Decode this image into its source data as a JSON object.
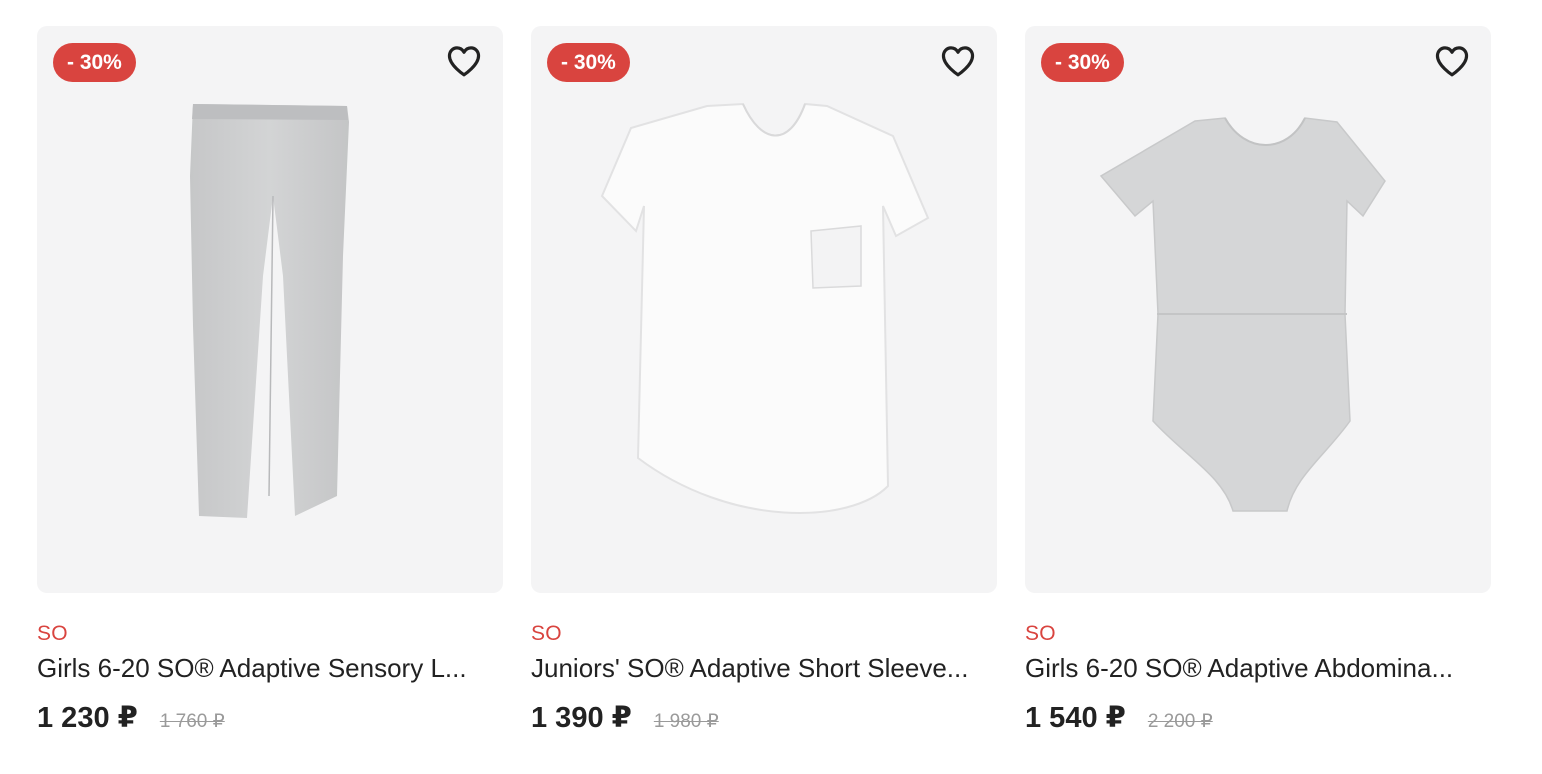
{
  "colors": {
    "accent": "#d9443f",
    "card_background": "#f4f4f5",
    "text": "#222222",
    "muted": "#9a9a9a"
  },
  "products": [
    {
      "badge": "- 30%",
      "favorite_icon": "heart-outline-icon",
      "image_subject": "leggings",
      "brand": "SO",
      "title": "Girls 6-20 SO® Adaptive Sensory L...",
      "price": "1 230 ₽",
      "old_price": "1 760 ₽"
    },
    {
      "badge": "- 30%",
      "favorite_icon": "heart-outline-icon",
      "image_subject": "t-shirt",
      "brand": "SO",
      "title": "Juniors' SO® Adaptive Short Sleeve...",
      "price": "1 390 ₽",
      "old_price": "1 980 ₽"
    },
    {
      "badge": "- 30%",
      "favorite_icon": "heart-outline-icon",
      "image_subject": "bodysuit",
      "brand": "SO",
      "title": "Girls 6-20 SO® Adaptive Abdomina...",
      "price": "1 540 ₽",
      "old_price": "2 200 ₽"
    }
  ]
}
